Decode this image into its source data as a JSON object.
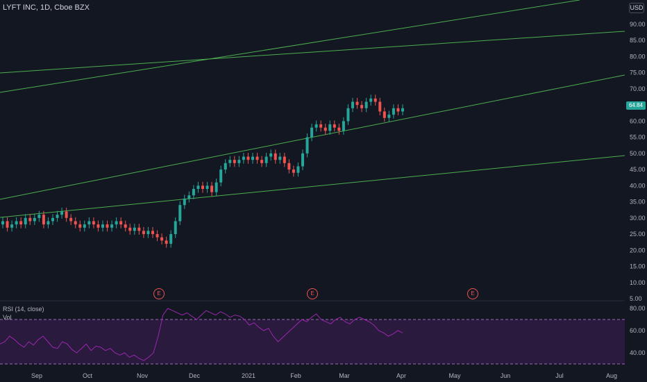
{
  "header": {
    "title": "LYFT INC, 1D, Cboe BZX",
    "currency": "USD"
  },
  "price_axis": {
    "labels": [
      "90.00",
      "85.00",
      "80.00",
      "75.00",
      "70.00",
      "65.00",
      "60.00",
      "55.00",
      "50.00",
      "45.00",
      "40.00",
      "35.00",
      "30.00",
      "25.00",
      "20.00",
      "15.00",
      "10.00",
      "5.00"
    ]
  },
  "current_price_label": "64.84",
  "rsi_panel": {
    "indicator_label": "RSI (14, close)",
    "volume_label": "Vol",
    "axis_labels": [
      "80.00",
      "60.00",
      "40.00"
    ]
  },
  "time_axis": {
    "labels": [
      "Sep",
      "Oct",
      "Nov",
      "Dec",
      "2021",
      "Feb",
      "Mar",
      "Apr",
      "May",
      "Jun",
      "Jul",
      "Aug"
    ]
  },
  "earnings_marker": "E",
  "colors": {
    "background": "#131722",
    "up": "#26a69a",
    "down": "#ef5350",
    "trendline": "#4caf50",
    "rsi_line": "#9c27b0",
    "rsi_band": "#2a1a3d"
  },
  "chart_data": {
    "type": "candlestick",
    "ylim": [
      5,
      90
    ],
    "series": [
      {
        "values": [
          29,
          27,
          28,
          29,
          28,
          30,
          29,
          30,
          31,
          28,
          29,
          30,
          31,
          32,
          30,
          29,
          28,
          27,
          28,
          29,
          28,
          27,
          28,
          27,
          28,
          29,
          28,
          27,
          26,
          27,
          26,
          25,
          26,
          25,
          24,
          23,
          22,
          25,
          29,
          34,
          36,
          37,
          39,
          40,
          39,
          40,
          38,
          41,
          45,
          47,
          48,
          47,
          48,
          49,
          48,
          49,
          48,
          47,
          49,
          50,
          48,
          49,
          47,
          45,
          44,
          46,
          50,
          55,
          58,
          59,
          58,
          57,
          59,
          58,
          57,
          60,
          64,
          66,
          65,
          64,
          66,
          67,
          66,
          63,
          61,
          62,
          64,
          63,
          64
        ]
      }
    ]
  },
  "rsi_data": {
    "ylim": [
      30,
      85
    ],
    "values": [
      48,
      50,
      55,
      52,
      48,
      45,
      50,
      47,
      52,
      55,
      50,
      45,
      44,
      50,
      48,
      43,
      40,
      44,
      48,
      42,
      46,
      45,
      42,
      44,
      40,
      38,
      40,
      36,
      38,
      35,
      33,
      36,
      40,
      55,
      74,
      80,
      78,
      76,
      74,
      76,
      73,
      70,
      74,
      78,
      76,
      74,
      77,
      75,
      72,
      74,
      73,
      70,
      65,
      67,
      63,
      60,
      62,
      55,
      50,
      54,
      58,
      62,
      66,
      70,
      68,
      72,
      75,
      70,
      68,
      66,
      70,
      72,
      68,
      66,
      70,
      72,
      70,
      68,
      65,
      60,
      58,
      55,
      57,
      60,
      58
    ]
  }
}
